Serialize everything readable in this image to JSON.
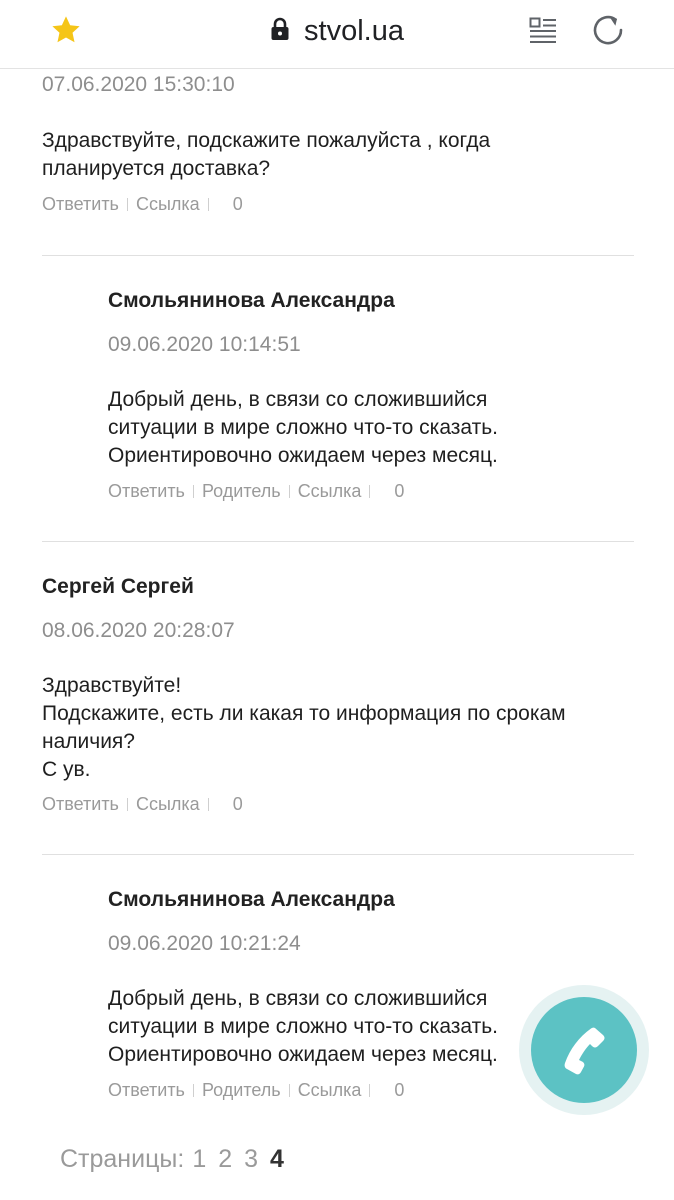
{
  "browser": {
    "url": "stvol.ua",
    "icons": {
      "bookmark": "star-icon",
      "secure": "lock-icon",
      "reader_mode": "reader-mode-icon",
      "reload": "reload-icon"
    },
    "colors": {
      "star": "#f5c518",
      "icons": "#5f6368"
    }
  },
  "comments": [
    {
      "type": "comment",
      "author": "",
      "date": "07.06.2020 15:30:10",
      "text": "Здравствуйте, подскажите пожалуйста , когда\nпланируется доставка?",
      "actions": {
        "reply": "Ответить",
        "link": "Ссылка",
        "count": "0"
      }
    },
    {
      "type": "reply",
      "author": "Смольянинова Александра",
      "date": "09.06.2020 10:14:51",
      "text": "Добрый день, в связи со сложившийся\nситуации в мире сложно что-то сказать.\nОриентировочно ожидаем через месяц.",
      "actions": {
        "reply": "Ответить",
        "parent": "Родитель",
        "link": "Ссылка",
        "count": "0"
      }
    },
    {
      "type": "comment",
      "author": "Сергей Сергей",
      "date": "08.06.2020 20:28:07",
      "text": "Здравствуйте!\nПодскажите, есть ли какая то информация по срокам\nналичия?\nС ув.",
      "actions": {
        "reply": "Ответить",
        "link": "Ссылка",
        "count": "0"
      }
    },
    {
      "type": "reply",
      "author": "Смольянинова Александра",
      "date": "09.06.2020 10:21:24",
      "text": "Добрый день, в связи со сложившийся\nситуации в мире сложно что-то сказать.\nОриентировочно ожидаем через месяц.",
      "actions": {
        "reply": "Ответить",
        "parent": "Родитель",
        "link": "Ссылка",
        "count": "0"
      }
    }
  ],
  "pagination": {
    "label": "Страницы:",
    "pages": [
      "1",
      "2",
      "3",
      "4"
    ],
    "current": "4"
  },
  "call_button": {
    "icon": "phone-icon",
    "color": "#5cc2c4"
  }
}
